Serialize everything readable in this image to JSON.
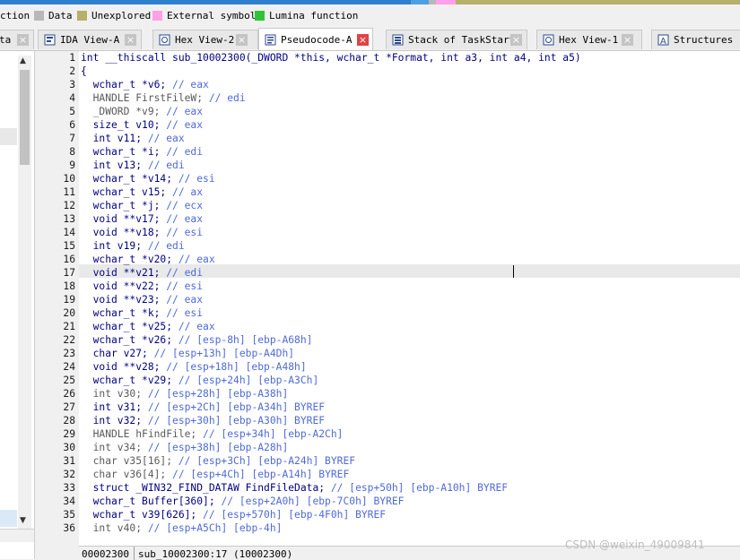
{
  "legend": {
    "items": [
      {
        "label": "ction",
        "color": ""
      },
      {
        "label": "Data",
        "color": "#b8b8b8"
      },
      {
        "label": "Unexplored",
        "color": "#b5b06a"
      },
      {
        "label": "External symbol",
        "color": "#ffa0e8"
      },
      {
        "label": "Lumina function",
        "color": "#2ec438"
      }
    ]
  },
  "left_tab_label": "ta",
  "tabs": [
    {
      "label": "IDA View-A",
      "icon": "ida-view-icon"
    },
    {
      "label": "Hex View-2",
      "icon": "hex-view-icon"
    },
    {
      "label": "Pseudocode-A",
      "icon": "pseudocode-icon"
    },
    {
      "label": "Stack of TaskStart",
      "icon": "stack-icon"
    },
    {
      "label": "Hex View-1",
      "icon": "hex-view-icon"
    },
    {
      "label": "Structures",
      "icon": "structures-icon"
    }
  ],
  "close_glyph": "×",
  "code_lines": [
    {
      "n": "1",
      "code": "int __thiscall sub_10002300(_DWORD *this, wchar_t *Format, int a3, int a4, int a5)",
      "comment": ""
    },
    {
      "n": "2",
      "code": "{",
      "comment": ""
    },
    {
      "n": "3",
      "code": "  wchar_t *v6; ",
      "comment": "// eax"
    },
    {
      "n": "4",
      "code": "  HANDLE FirstFileW; ",
      "comment": "// edi"
    },
    {
      "n": "5",
      "code": "  _DWORD *v9; ",
      "comment": "// eax"
    },
    {
      "n": "6",
      "code": "  size_t v10; ",
      "comment": "// eax"
    },
    {
      "n": "7",
      "code": "  int v11; ",
      "comment": "// eax"
    },
    {
      "n": "8",
      "code": "  wchar_t *i; ",
      "comment": "// edi"
    },
    {
      "n": "9",
      "code": "  int v13; ",
      "comment": "// edi"
    },
    {
      "n": "10",
      "code": "  wchar_t *v14; ",
      "comment": "// esi"
    },
    {
      "n": "11",
      "code": "  wchar_t v15; ",
      "comment": "// ax"
    },
    {
      "n": "12",
      "code": "  wchar_t *j; ",
      "comment": "// ecx"
    },
    {
      "n": "13",
      "code": "  void **v17; ",
      "comment": "// eax"
    },
    {
      "n": "14",
      "code": "  void **v18; ",
      "comment": "// esi"
    },
    {
      "n": "15",
      "code": "  int v19; ",
      "comment": "// edi"
    },
    {
      "n": "16",
      "code": "  wchar_t *v20; ",
      "comment": "// eax"
    },
    {
      "n": "17",
      "code": "  void **v21; ",
      "comment": "// edi"
    },
    {
      "n": "18",
      "code": "  void **v22; ",
      "comment": "// esi"
    },
    {
      "n": "19",
      "code": "  void **v23; ",
      "comment": "// eax"
    },
    {
      "n": "20",
      "code": "  wchar_t *k; ",
      "comment": "// esi"
    },
    {
      "n": "21",
      "code": "  wchar_t *v25; ",
      "comment": "// eax"
    },
    {
      "n": "22",
      "code": "  wchar_t *v26; ",
      "comment": "// [esp-8h] [ebp-A68h]"
    },
    {
      "n": "23",
      "code": "  char v27; ",
      "comment": "// [esp+13h] [ebp-A4Dh]"
    },
    {
      "n": "24",
      "code": "  void **v28; ",
      "comment": "// [esp+18h] [ebp-A48h]"
    },
    {
      "n": "25",
      "code": "  wchar_t *v29; ",
      "comment": "// [esp+24h] [ebp-A3Ch]"
    },
    {
      "n": "26",
      "code": "  int v30; ",
      "comment": "// [esp+28h] [ebp-A38h]"
    },
    {
      "n": "27",
      "code": "  int v31; ",
      "comment": "// [esp+2Ch] [ebp-A34h] BYREF"
    },
    {
      "n": "28",
      "code": "  int v32; ",
      "comment": "// [esp+30h] [ebp-A30h] BYREF"
    },
    {
      "n": "29",
      "code": "  HANDLE hFindFile; ",
      "comment": "// [esp+34h] [ebp-A2Ch]"
    },
    {
      "n": "30",
      "code": "  int v34; ",
      "comment": "// [esp+38h] [ebp-A28h]"
    },
    {
      "n": "31",
      "code": "  char v35[16]; ",
      "comment": "// [esp+3Ch] [ebp-A24h] BYREF"
    },
    {
      "n": "32",
      "code": "  char v36[4]; ",
      "comment": "// [esp+4Ch] [ebp-A14h] BYREF"
    },
    {
      "n": "33",
      "code": "  struct _WIN32_FIND_DATAW FindFileData; ",
      "comment": "// [esp+50h] [ebp-A10h] BYREF"
    },
    {
      "n": "34",
      "code": "  wchar_t Buffer[360]; ",
      "comment": "// [esp+2A0h] [ebp-7C0h] BYREF"
    },
    {
      "n": "35",
      "code": "  wchar_t v39[626]; ",
      "comment": "// [esp+570h] [ebp-4F0h] BYREF"
    },
    {
      "n": "36",
      "code": "  int v40; ",
      "comment": "// [esp+A5Ch] [ebp-4h]"
    }
  ],
  "status": {
    "address": "00002300",
    "location": "sub_10002300:17 (10002300)"
  },
  "watermark": "CSDN @weixin_49009841"
}
